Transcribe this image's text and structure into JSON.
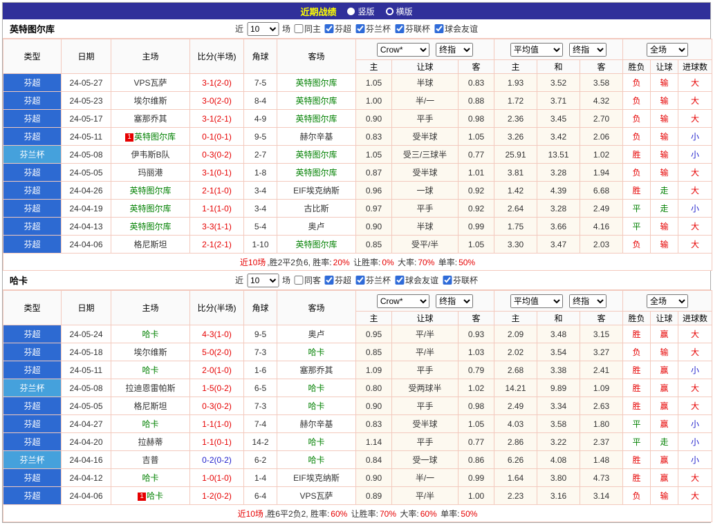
{
  "top_bar": {
    "title": "近期战绩",
    "radios": [
      {
        "label": "竖版",
        "checked": false
      },
      {
        "label": "横版",
        "checked": true
      }
    ]
  },
  "table_header": {
    "col_type": "类型",
    "col_date": "日期",
    "col_home": "主场",
    "col_score": "比分(半场)",
    "col_corner": "角球",
    "col_away": "客场",
    "book_select": "Crow*",
    "final_select": "终指",
    "avg_select": "平均值",
    "scope_select": "全场",
    "sub_home": "主",
    "sub_handicap": "让球",
    "sub_away": "客",
    "sub_draw": "和",
    "col_result": "胜负",
    "col_handicap_result": "让球",
    "col_goals": "进球数"
  },
  "colors": {
    "topbar_bg": "#30309a",
    "title_yellow": "#ffff00",
    "league_super_blue": "#2d6ad2",
    "league_cup_blue": "#45a1dc",
    "result_red": "#e60000",
    "draw_green": "#008000",
    "goals_blue": "#2222cc",
    "focal_team_green": "#008000",
    "grid_pink": "#f3c9bd"
  },
  "sections": [
    {
      "team": "英特图尔库",
      "filters": {
        "prefix": "近",
        "recent_value": "10",
        "suffix": "场",
        "same_venue_label": "同主",
        "same_venue_checked": false,
        "leagues": [
          {
            "label": "芬超",
            "checked": true
          },
          {
            "label": "芬兰杯",
            "checked": true
          },
          {
            "label": "芬联杯",
            "checked": true
          },
          {
            "label": "球会友谊",
            "checked": true
          }
        ]
      },
      "rows": [
        {
          "lg": "芬超",
          "lt": "super",
          "date": "24-05-27",
          "home": "VPS瓦萨",
          "hf": false,
          "hb": "",
          "score": "3-1(2-0)",
          "sc": "red",
          "corner": "7-5",
          "away": "英特图尔库",
          "af": true,
          "ab": "",
          "h1": "1.05",
          "hc": "半球",
          "h2": "0.83",
          "e1": "1.93",
          "e2": "3.52",
          "e3": "3.58",
          "r1": "负",
          "r1c": "red",
          "r2": "输",
          "r2c": "red",
          "r3": "大",
          "r3c": "red"
        },
        {
          "lg": "芬超",
          "lt": "super",
          "date": "24-05-23",
          "home": "埃尔维斯",
          "hf": false,
          "hb": "",
          "score": "3-0(2-0)",
          "sc": "red",
          "corner": "8-4",
          "away": "英特图尔库",
          "af": true,
          "ab": "",
          "h1": "1.00",
          "hc": "半/一",
          "h2": "0.88",
          "e1": "1.72",
          "e2": "3.71",
          "e3": "4.32",
          "r1": "负",
          "r1c": "red",
          "r2": "输",
          "r2c": "red",
          "r3": "大",
          "r3c": "red"
        },
        {
          "lg": "芬超",
          "lt": "super",
          "date": "24-05-17",
          "home": "塞那乔其",
          "hf": false,
          "hb": "",
          "score": "3-1(2-1)",
          "sc": "red",
          "corner": "4-9",
          "away": "英特图尔库",
          "af": true,
          "ab": "",
          "h1": "0.90",
          "hc": "平手",
          "h2": "0.98",
          "e1": "2.36",
          "e2": "3.45",
          "e3": "2.70",
          "r1": "负",
          "r1c": "red",
          "r2": "输",
          "r2c": "red",
          "r3": "大",
          "r3c": "red"
        },
        {
          "lg": "芬超",
          "lt": "super",
          "date": "24-05-11",
          "home": "英特图尔库",
          "hf": true,
          "hb": "1",
          "score": "0-1(0-1)",
          "sc": "red",
          "corner": "9-5",
          "away": "赫尔辛基",
          "af": false,
          "ab": "",
          "h1": "0.83",
          "hc": "受半球",
          "h2": "1.05",
          "e1": "3.26",
          "e2": "3.42",
          "e3": "2.06",
          "r1": "负",
          "r1c": "red",
          "r2": "输",
          "r2c": "red",
          "r3": "小",
          "r3c": "blue"
        },
        {
          "lg": "芬兰杯",
          "lt": "cup",
          "date": "24-05-08",
          "home": "伊韦斯B队",
          "hf": false,
          "hb": "",
          "score": "0-3(0-2)",
          "sc": "red",
          "corner": "2-7",
          "away": "英特图尔库",
          "af": true,
          "ab": "",
          "h1": "1.05",
          "hc": "受三/三球半",
          "h2": "0.77",
          "e1": "25.91",
          "e2": "13.51",
          "e3": "1.02",
          "r1": "胜",
          "r1c": "red",
          "r2": "输",
          "r2c": "red",
          "r3": "小",
          "r3c": "blue"
        },
        {
          "lg": "芬超",
          "lt": "super",
          "date": "24-05-05",
          "home": "玛丽港",
          "hf": false,
          "hb": "",
          "score": "3-1(0-1)",
          "sc": "red",
          "corner": "1-8",
          "away": "英特图尔库",
          "af": true,
          "ab": "",
          "h1": "0.87",
          "hc": "受半球",
          "h2": "1.01",
          "e1": "3.81",
          "e2": "3.28",
          "e3": "1.94",
          "r1": "负",
          "r1c": "red",
          "r2": "输",
          "r2c": "red",
          "r3": "大",
          "r3c": "red"
        },
        {
          "lg": "芬超",
          "lt": "super",
          "date": "24-04-26",
          "home": "英特图尔库",
          "hf": true,
          "hb": "",
          "score": "2-1(1-0)",
          "sc": "red",
          "corner": "3-4",
          "away": "EIF埃克纳斯",
          "af": false,
          "ab": "",
          "h1": "0.96",
          "hc": "一球",
          "h2": "0.92",
          "e1": "1.42",
          "e2": "4.39",
          "e3": "6.68",
          "r1": "胜",
          "r1c": "red",
          "r2": "走",
          "r2c": "green",
          "r3": "大",
          "r3c": "red"
        },
        {
          "lg": "芬超",
          "lt": "super",
          "date": "24-04-19",
          "home": "英特图尔库",
          "hf": true,
          "hb": "",
          "score": "1-1(1-0)",
          "sc": "red",
          "corner": "3-4",
          "away": "古比斯",
          "af": false,
          "ab": "",
          "h1": "0.97",
          "hc": "平手",
          "h2": "0.92",
          "e1": "2.64",
          "e2": "3.28",
          "e3": "2.49",
          "r1": "平",
          "r1c": "green",
          "r2": "走",
          "r2c": "green",
          "r3": "小",
          "r3c": "blue"
        },
        {
          "lg": "芬超",
          "lt": "super",
          "date": "24-04-13",
          "home": "英特图尔库",
          "hf": true,
          "hb": "",
          "score": "3-3(1-1)",
          "sc": "red",
          "corner": "5-4",
          "away": "奥卢",
          "af": false,
          "ab": "",
          "h1": "0.90",
          "hc": "半球",
          "h2": "0.99",
          "e1": "1.75",
          "e2": "3.66",
          "e3": "4.16",
          "r1": "平",
          "r1c": "green",
          "r2": "输",
          "r2c": "red",
          "r3": "大",
          "r3c": "red"
        },
        {
          "lg": "芬超",
          "lt": "super",
          "date": "24-04-06",
          "home": "格尼斯坦",
          "hf": false,
          "hb": "",
          "score": "2-1(2-1)",
          "sc": "red",
          "corner": "1-10",
          "away": "英特图尔库",
          "af": true,
          "ab": "",
          "h1": "0.85",
          "hc": "受平/半",
          "h2": "1.05",
          "e1": "3.30",
          "e2": "3.47",
          "e3": "2.03",
          "r1": "负",
          "r1c": "red",
          "r2": "输",
          "r2c": "red",
          "r3": "大",
          "r3c": "red"
        }
      ],
      "summary": [
        {
          "t": "近10场",
          "c": "red"
        },
        {
          "t": ",胜2平2负6, 胜率:",
          "c": "black"
        },
        {
          "t": "20%",
          "c": "red"
        },
        {
          "t": " 让胜率:",
          "c": "black"
        },
        {
          "t": "0%",
          "c": "red"
        },
        {
          "t": " 大率:",
          "c": "black"
        },
        {
          "t": "70%",
          "c": "red"
        },
        {
          "t": " 单率:",
          "c": "black"
        },
        {
          "t": "50%",
          "c": "red"
        }
      ]
    },
    {
      "team": "哈卡",
      "filters": {
        "prefix": "近",
        "recent_value": "10",
        "suffix": "场",
        "same_venue_label": "同客",
        "same_venue_checked": false,
        "leagues": [
          {
            "label": "芬超",
            "checked": true
          },
          {
            "label": "芬兰杯",
            "checked": true
          },
          {
            "label": "球会友谊",
            "checked": true
          },
          {
            "label": "芬联杯",
            "checked": true
          }
        ]
      },
      "rows": [
        {
          "lg": "芬超",
          "lt": "super",
          "date": "24-05-24",
          "home": "哈卡",
          "hf": true,
          "hb": "",
          "score": "4-3(1-0)",
          "sc": "red",
          "corner": "9-5",
          "away": "奥卢",
          "af": false,
          "ab": "",
          "h1": "0.95",
          "hc": "平/半",
          "h2": "0.93",
          "e1": "2.09",
          "e2": "3.48",
          "e3": "3.15",
          "r1": "胜",
          "r1c": "red",
          "r2": "赢",
          "r2c": "red",
          "r3": "大",
          "r3c": "red"
        },
        {
          "lg": "芬超",
          "lt": "super",
          "date": "24-05-18",
          "home": "埃尔维斯",
          "hf": false,
          "hb": "",
          "score": "5-0(2-0)",
          "sc": "red",
          "corner": "7-3",
          "away": "哈卡",
          "af": true,
          "ab": "",
          "h1": "0.85",
          "hc": "平/半",
          "h2": "1.03",
          "e1": "2.02",
          "e2": "3.54",
          "e3": "3.27",
          "r1": "负",
          "r1c": "red",
          "r2": "输",
          "r2c": "red",
          "r3": "大",
          "r3c": "red"
        },
        {
          "lg": "芬超",
          "lt": "super",
          "date": "24-05-11",
          "home": "哈卡",
          "hf": true,
          "hb": "",
          "score": "2-0(1-0)",
          "sc": "red",
          "corner": "1-6",
          "away": "塞那乔其",
          "af": false,
          "ab": "",
          "h1": "1.09",
          "hc": "平手",
          "h2": "0.79",
          "e1": "2.68",
          "e2": "3.38",
          "e3": "2.41",
          "r1": "胜",
          "r1c": "red",
          "r2": "赢",
          "r2c": "red",
          "r3": "小",
          "r3c": "blue"
        },
        {
          "lg": "芬兰杯",
          "lt": "cup",
          "date": "24-05-08",
          "home": "拉迪恩雷帕斯",
          "hf": false,
          "hb": "",
          "score": "1-5(0-2)",
          "sc": "red",
          "corner": "6-5",
          "away": "哈卡",
          "af": true,
          "ab": "",
          "h1": "0.80",
          "hc": "受两球半",
          "h2": "1.02",
          "e1": "14.21",
          "e2": "9.89",
          "e3": "1.09",
          "r1": "胜",
          "r1c": "red",
          "r2": "赢",
          "r2c": "red",
          "r3": "大",
          "r3c": "red"
        },
        {
          "lg": "芬超",
          "lt": "super",
          "date": "24-05-05",
          "home": "格尼斯坦",
          "hf": false,
          "hb": "",
          "score": "0-3(0-2)",
          "sc": "red",
          "corner": "7-3",
          "away": "哈卡",
          "af": true,
          "ab": "",
          "h1": "0.90",
          "hc": "平手",
          "h2": "0.98",
          "e1": "2.49",
          "e2": "3.34",
          "e3": "2.63",
          "r1": "胜",
          "r1c": "red",
          "r2": "赢",
          "r2c": "red",
          "r3": "大",
          "r3c": "red"
        },
        {
          "lg": "芬超",
          "lt": "super",
          "date": "24-04-27",
          "home": "哈卡",
          "hf": true,
          "hb": "",
          "score": "1-1(1-0)",
          "sc": "red",
          "corner": "7-4",
          "away": "赫尔辛基",
          "af": false,
          "ab": "",
          "h1": "0.83",
          "hc": "受半球",
          "h2": "1.05",
          "e1": "4.03",
          "e2": "3.58",
          "e3": "1.80",
          "r1": "平",
          "r1c": "green",
          "r2": "赢",
          "r2c": "red",
          "r3": "小",
          "r3c": "blue"
        },
        {
          "lg": "芬超",
          "lt": "super",
          "date": "24-04-20",
          "home": "拉赫蒂",
          "hf": false,
          "hb": "",
          "score": "1-1(0-1)",
          "sc": "red",
          "corner": "14-2",
          "away": "哈卡",
          "af": true,
          "ab": "",
          "h1": "1.14",
          "hc": "平手",
          "h2": "0.77",
          "e1": "2.86",
          "e2": "3.22",
          "e3": "2.37",
          "r1": "平",
          "r1c": "green",
          "r2": "走",
          "r2c": "green",
          "r3": "小",
          "r3c": "blue"
        },
        {
          "lg": "芬兰杯",
          "lt": "cup",
          "date": "24-04-16",
          "home": "吉普",
          "hf": false,
          "hb": "",
          "score": "0-2(0-2)",
          "sc": "blue",
          "corner": "6-2",
          "away": "哈卡",
          "af": true,
          "ab": "",
          "h1": "0.84",
          "hc": "受一球",
          "h2": "0.86",
          "e1": "6.26",
          "e2": "4.08",
          "e3": "1.48",
          "r1": "胜",
          "r1c": "red",
          "r2": "赢",
          "r2c": "red",
          "r3": "小",
          "r3c": "blue"
        },
        {
          "lg": "芬超",
          "lt": "super",
          "date": "24-04-12",
          "home": "哈卡",
          "hf": true,
          "hb": "",
          "score": "1-0(1-0)",
          "sc": "red",
          "corner": "1-4",
          "away": "EIF埃克纳斯",
          "af": false,
          "ab": "",
          "h1": "0.90",
          "hc": "半/一",
          "h2": "0.99",
          "e1": "1.64",
          "e2": "3.80",
          "e3": "4.73",
          "r1": "胜",
          "r1c": "red",
          "r2": "赢",
          "r2c": "red",
          "r3": "大",
          "r3c": "red"
        },
        {
          "lg": "芬超",
          "lt": "super",
          "date": "24-04-06",
          "home": "哈卡",
          "hf": true,
          "hb": "1",
          "score": "1-2(0-2)",
          "sc": "red",
          "corner": "6-4",
          "away": "VPS瓦萨",
          "af": false,
          "ab": "",
          "h1": "0.89",
          "hc": "平/半",
          "h2": "1.00",
          "e1": "2.23",
          "e2": "3.16",
          "e3": "3.14",
          "r1": "负",
          "r1c": "red",
          "r2": "输",
          "r2c": "red",
          "r3": "大",
          "r3c": "red"
        }
      ],
      "summary": [
        {
          "t": "近10场",
          "c": "red"
        },
        {
          "t": ",胜6平2负2, 胜率:",
          "c": "black"
        },
        {
          "t": "60%",
          "c": "red"
        },
        {
          "t": " 让胜率:",
          "c": "black"
        },
        {
          "t": "70%",
          "c": "red"
        },
        {
          "t": " 大率:",
          "c": "black"
        },
        {
          "t": "60%",
          "c": "red"
        },
        {
          "t": " 单率:",
          "c": "black"
        },
        {
          "t": "50%",
          "c": "red"
        }
      ]
    }
  ]
}
